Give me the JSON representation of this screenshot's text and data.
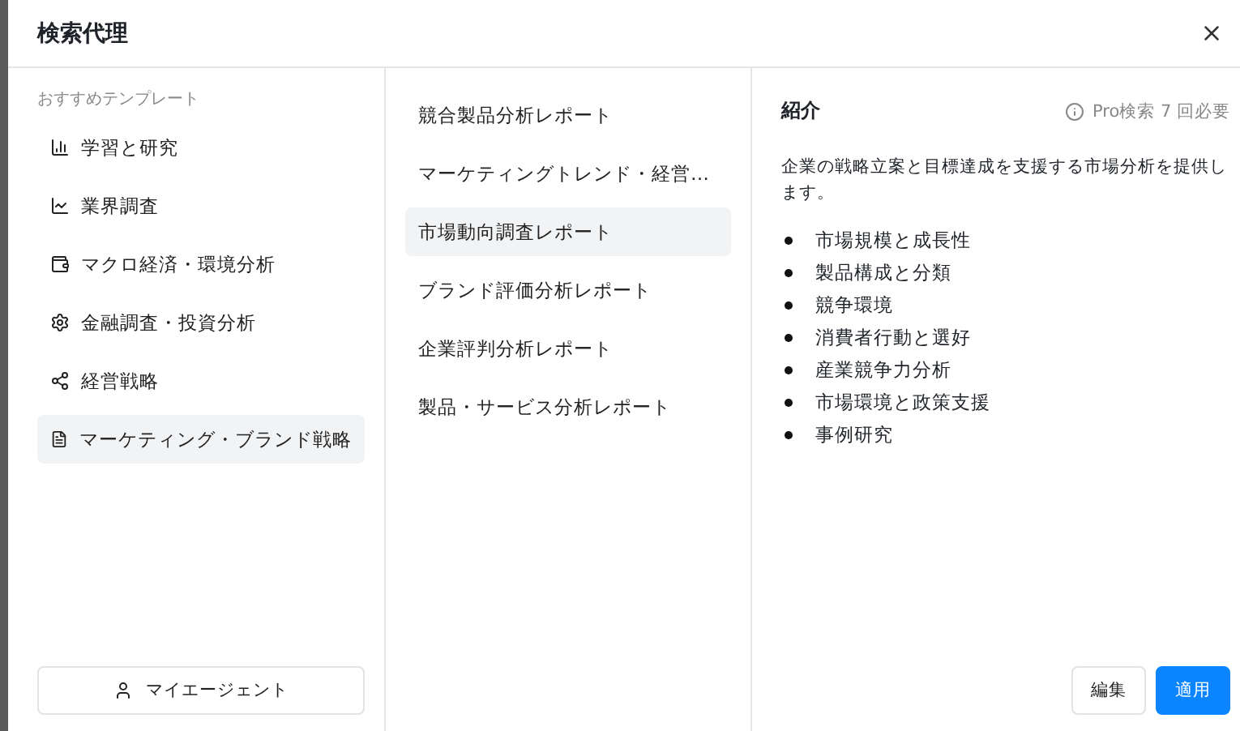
{
  "window": {
    "title": "検索代理"
  },
  "sidebar": {
    "heading": "おすすめテンプレート",
    "items": [
      {
        "label": "学習と研究",
        "selected": false
      },
      {
        "label": "業界調査",
        "selected": false
      },
      {
        "label": "マクロ経済・環境分析",
        "selected": false
      },
      {
        "label": "金融調査・投資分析",
        "selected": false
      },
      {
        "label": "経営戦略",
        "selected": false
      },
      {
        "label": "マーケティング・ブランド戦略",
        "selected": true
      }
    ],
    "my_agent_button": "マイエージェント"
  },
  "templates": [
    {
      "label": "競合製品分析レポート",
      "selected": false
    },
    {
      "label": "マーケティングトレンド・経営…",
      "selected": false
    },
    {
      "label": "市場動向調査レポート",
      "selected": true
    },
    {
      "label": "ブランド評価分析レポート",
      "selected": false
    },
    {
      "label": "企業評判分析レポート",
      "selected": false
    },
    {
      "label": "製品・サービス分析レポート",
      "selected": false
    }
  ],
  "detail": {
    "heading": "紹介",
    "requirement": "Pro検索 7 回必要",
    "description": "企業の戦略立案と目標達成を支援する市場分析を提供します。",
    "points": [
      "市場規模と成長性",
      "製品構成と分類",
      "競争環境",
      "消費者行動と選好",
      "産業競争力分析",
      "市場環境と政策支援",
      "事例研究"
    ]
  },
  "buttons": {
    "edit": "編集",
    "apply": "適用"
  }
}
